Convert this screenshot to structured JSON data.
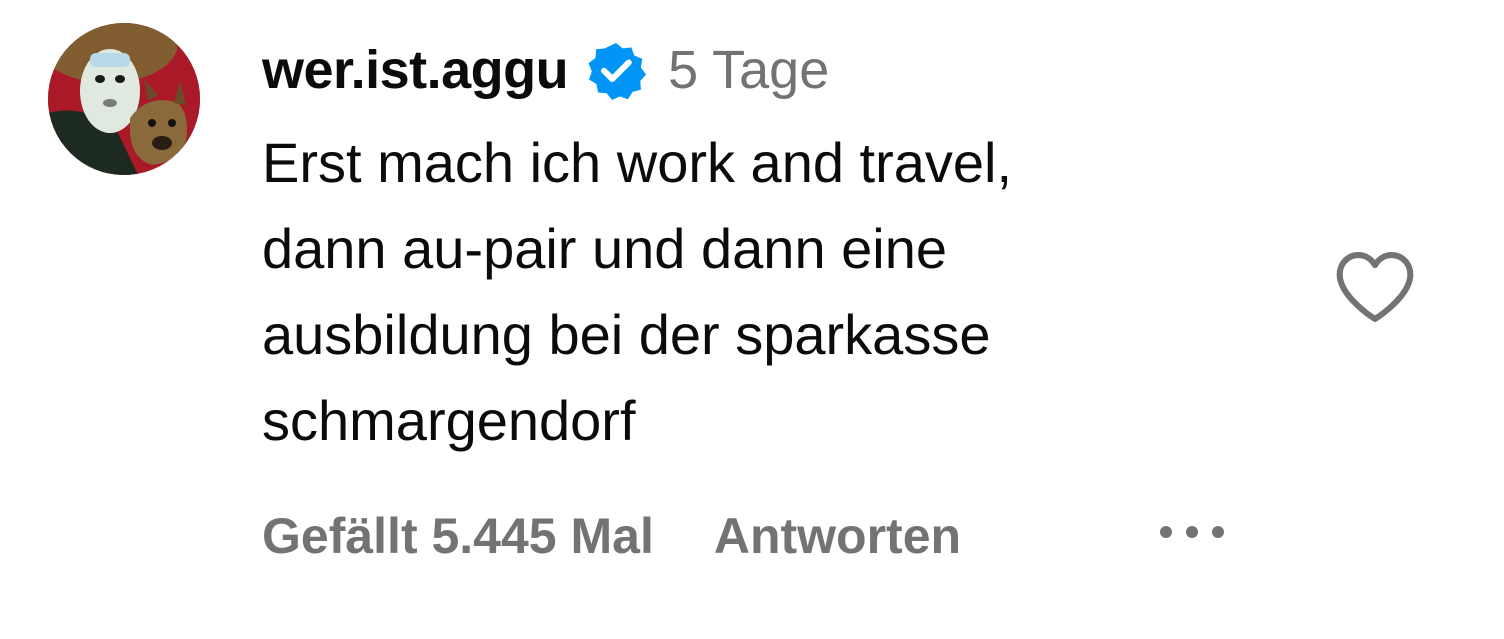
{
  "comment": {
    "username": "wer.ist.aggu",
    "timestamp": "5 Tage",
    "text_lines": [
      "Erst mach ich work and travel,",
      "dann au-pair und dann eine",
      "ausbildung bei der sparkasse",
      "schmargendorf"
    ],
    "likes_label": "Gefällt 5.445 Mal",
    "reply_label": "Antworten"
  },
  "icons": {
    "avatar": "avatar-image",
    "verified": "verified-badge-icon",
    "like": "heart-outline-icon",
    "more": "more-options-icon"
  },
  "colors": {
    "text_primary": "#0b0b0b",
    "text_secondary": "#737373",
    "verified_blue": "#0095f6",
    "icon_gray": "#737373"
  }
}
